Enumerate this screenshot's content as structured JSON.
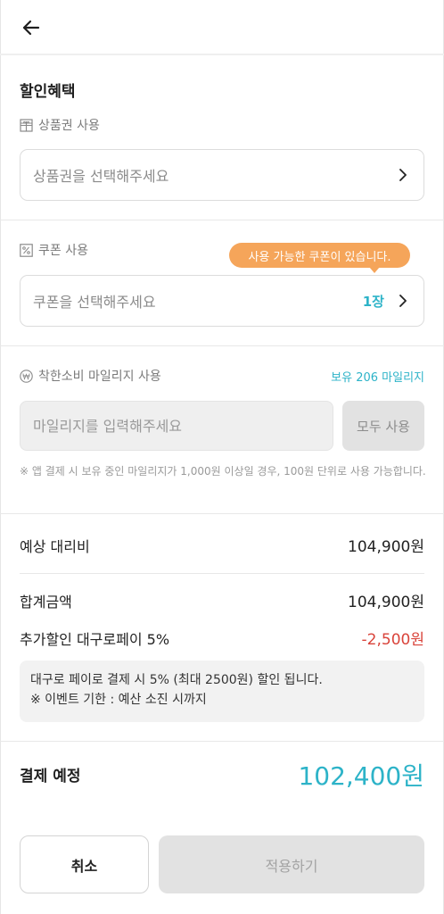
{
  "header": {
    "back_icon": "arrow-left-icon"
  },
  "discount": {
    "title": "할인혜택",
    "voucher": {
      "label": "상품권 사용",
      "icon": "gift-voucher-icon",
      "placeholder": "상품권을 선택해주세요"
    },
    "coupon": {
      "label": "쿠폰 사용",
      "icon": "percent-icon",
      "tooltip": "사용 가능한 쿠폰이 있습니다.",
      "placeholder": "쿠폰을 선택해주세요",
      "count": "1장"
    },
    "mileage": {
      "label": "착한소비 마일리지 사용",
      "icon": "won-circle-icon",
      "balance": "보유 206 마일리지",
      "input_placeholder": "마일리지를 입력해주세요",
      "use_all_label": "모두 사용",
      "note": "※ 앱 결제 시 보유 중인 마일리지가 1,000원 이상일 경우, 100원 단위로 사용 가능합니다."
    }
  },
  "summary": {
    "expected_label": "예상 대리비",
    "expected_value": "104,900원",
    "total_label": "합계금액",
    "total_value": "104,900원",
    "extra_label": "추가할인 대구로페이 5%",
    "extra_value": "-2,500원",
    "info_line1": "대구로 페이로 결제 시 5% (최대 2500원) 할인 됩니다.",
    "info_line2": "※ 이벤트 기한 : 예산 소진 시까지"
  },
  "payment": {
    "label": "결제 예정",
    "amount": "102,400원"
  },
  "actions": {
    "cancel_label": "취소",
    "apply_label": "적용하기"
  },
  "colors": {
    "accent": "#2db3c8",
    "tooltip": "#f5a55a",
    "negative": "#d9433a"
  }
}
